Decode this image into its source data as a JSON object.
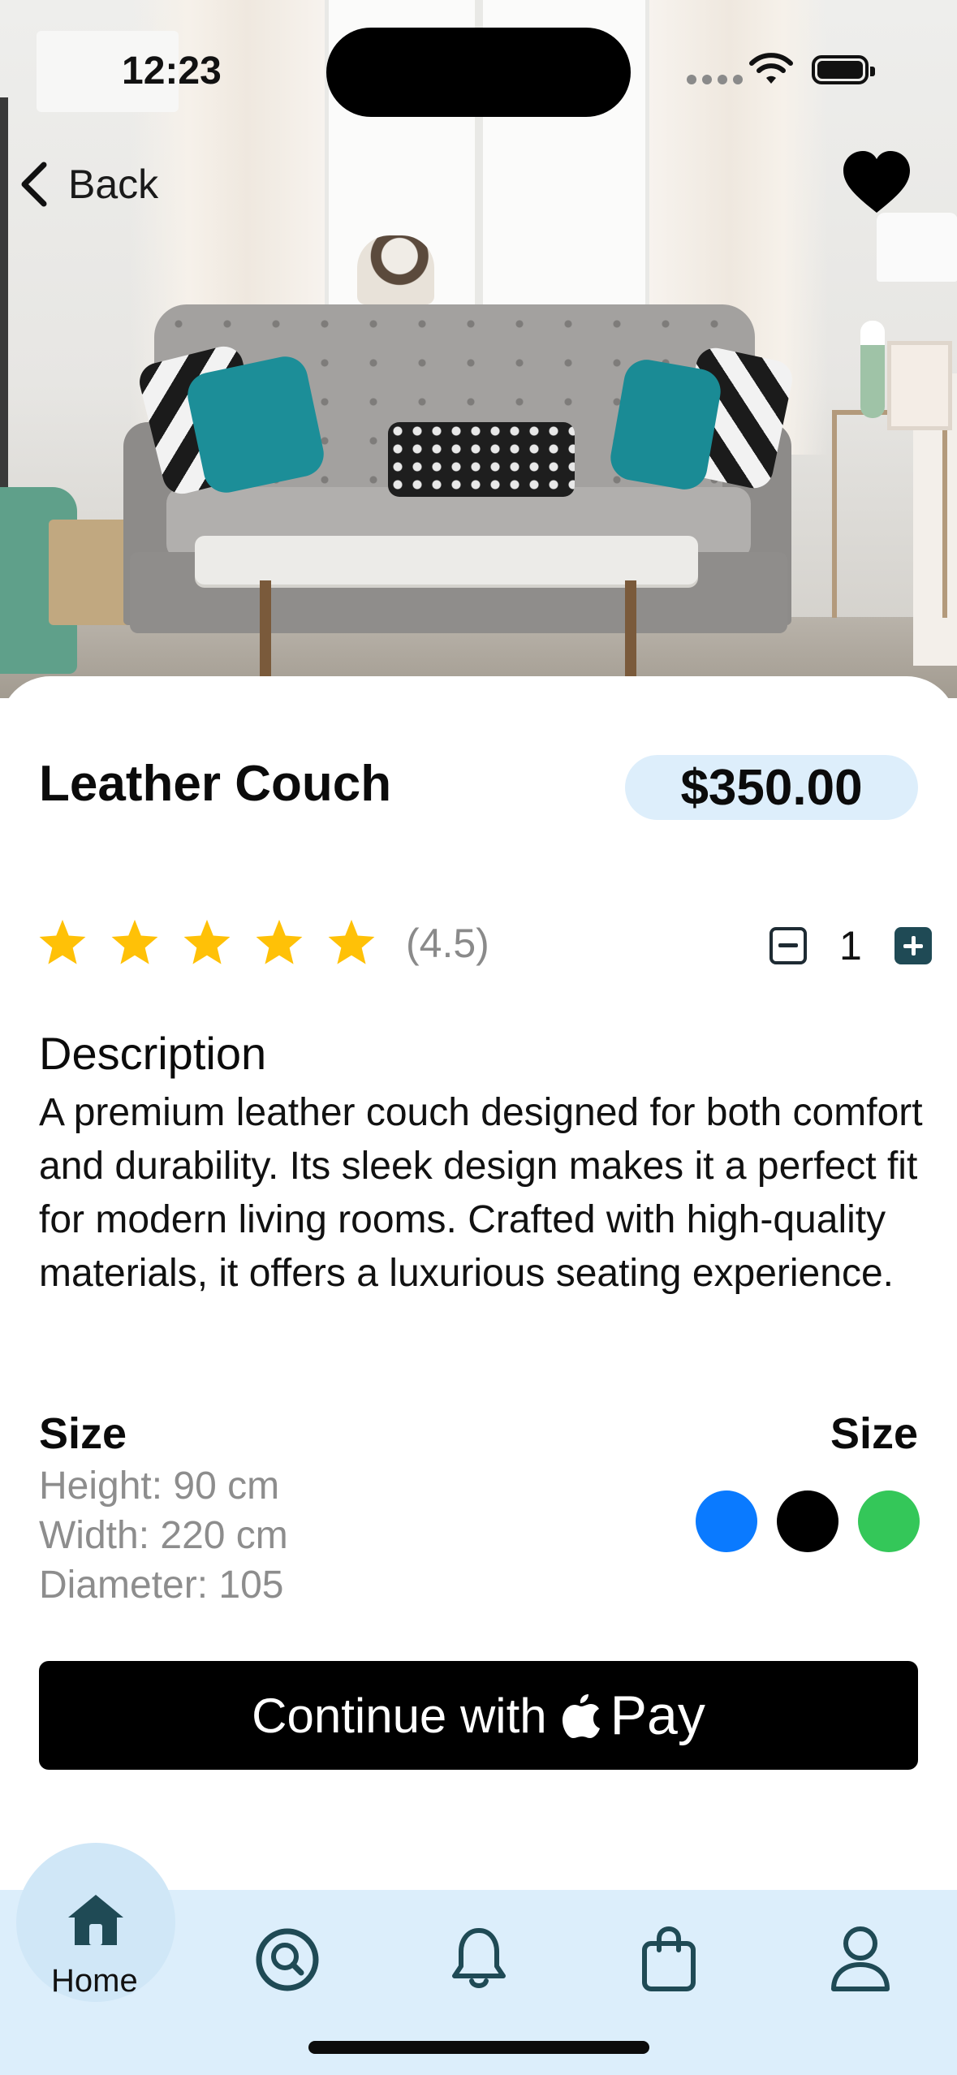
{
  "status_bar": {
    "time": "12:23"
  },
  "nav": {
    "back_label": "Back",
    "favorite_icon": "heart-icon"
  },
  "product": {
    "title": "Leather Couch",
    "price": "$350.00",
    "rating": {
      "value": 4.5,
      "max": 5,
      "text": "(4.5)"
    },
    "quantity": "1",
    "description_heading": "Description",
    "description": "A premium leather couch designed for both comfort and durability. Its sleek design makes it a perfect fit for modern living rooms. Crafted with high-quality materials, it offers a luxurious seating experience."
  },
  "size": {
    "heading_left": "Size",
    "heading_right": "Size",
    "height": "Height: 90 cm",
    "width": "Width: 220 cm",
    "diameter": "Diameter: 105"
  },
  "colors": [
    "#0a7aff",
    "#000000",
    "#34c759"
  ],
  "checkout": {
    "label": "Continue with",
    "pay_label": "Pay",
    "logo_icon": "apple-icon"
  },
  "tab_bar": {
    "items": [
      {
        "label": "Home",
        "icon": "home-icon",
        "active": true
      },
      {
        "label": "",
        "icon": "search-icon",
        "active": false
      },
      {
        "label": "",
        "icon": "bell-icon",
        "active": false
      },
      {
        "label": "",
        "icon": "shopping-bag-icon",
        "active": false
      },
      {
        "label": "",
        "icon": "profile-icon",
        "active": false
      }
    ]
  },
  "theme": {
    "accent": "#1f4a55",
    "price_pill": "#ddeefb",
    "tab_bar_bg": "#dceefb",
    "star": "#ffc107"
  }
}
